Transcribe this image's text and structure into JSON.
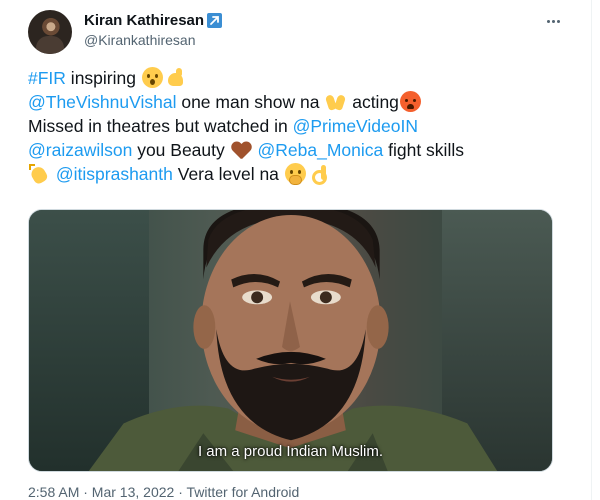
{
  "author": {
    "display_name": "Kiran Kathiresan",
    "handle": "@Kirankathiresan",
    "badge_icon": "arrow-badge-icon"
  },
  "tweet": {
    "hashtag": "#FIR",
    "word_inspiring": " inspiring ",
    "mention_vishnu": "@TheVishnuVishal",
    "text_one_man": " one man show na ",
    "text_acting": " acting",
    "text_missed": "Missed in theatres but watched in ",
    "mention_prime": "@PrimeVideoIN",
    "mention_raiza": "@raizawilson",
    "text_beauty": " you Beauty ",
    "mention_reba": "@Reba_Monica",
    "text_fight": " fight skills",
    "mention_prashanth": "@itisprashanth",
    "text_vera": " Vera level na ",
    "emojis": [
      "hushed-face-icon",
      "flexed-biceps-icon",
      "raising-hands-icon",
      "hot-face-icon",
      "brown-heart-icon",
      "clapping-hands-icon",
      "face-with-hand-over-mouth-icon",
      "ok-hand-icon"
    ]
  },
  "media": {
    "subtitle": "I am a proud Indian Muslim."
  },
  "meta": {
    "text": "2:58 AM · Mar 13, 2022 · Twitter for Android"
  },
  "colors": {
    "link": "#1d9bf0",
    "secondary_text": "#536471",
    "primary_text": "#0f1419"
  }
}
